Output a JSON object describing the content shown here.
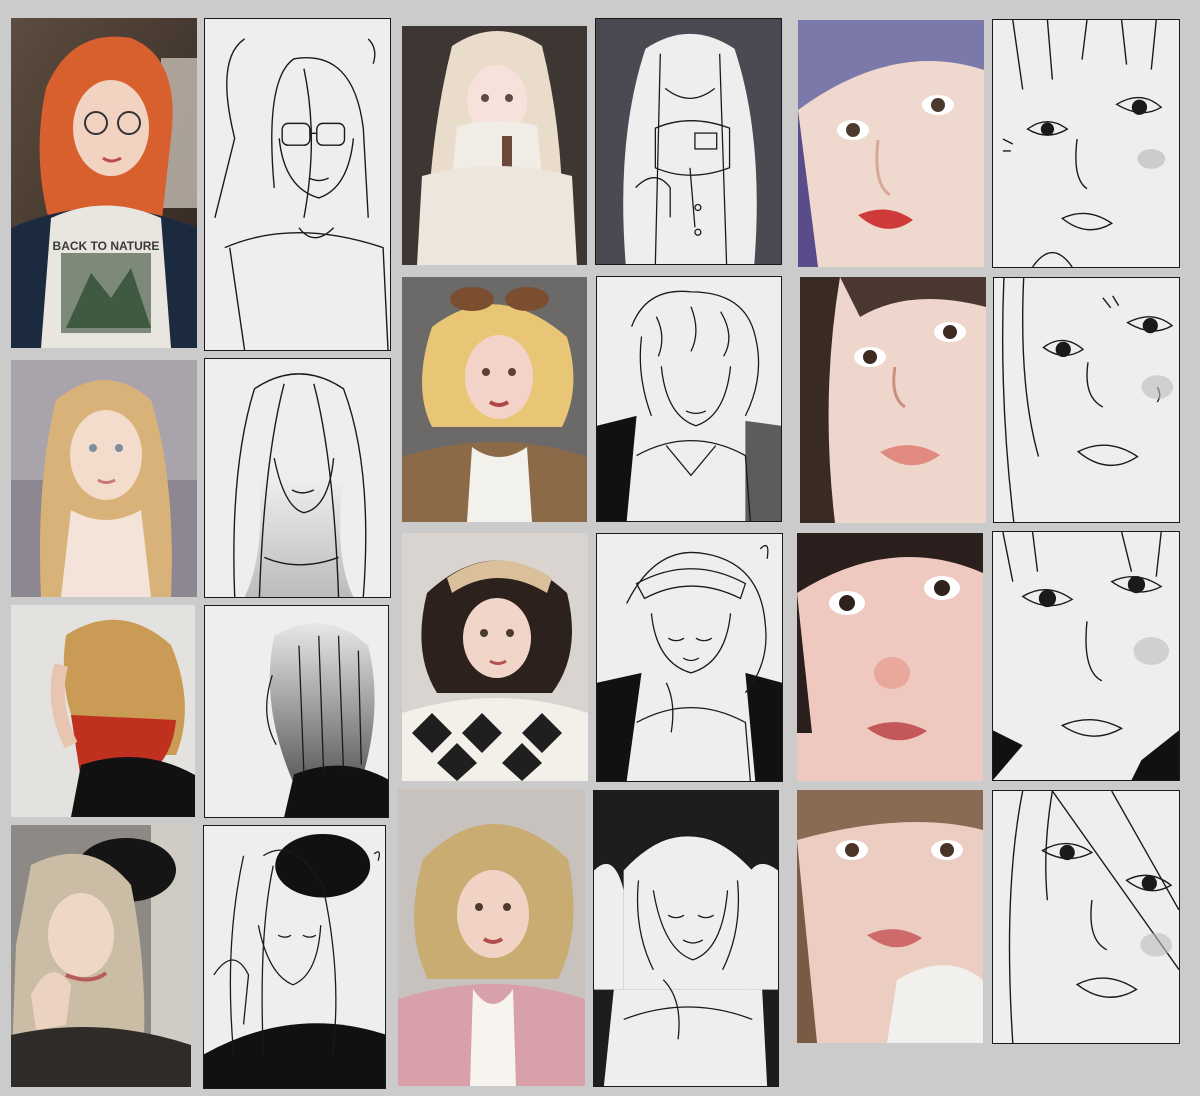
{
  "board": {
    "background": "#cbcbcb",
    "sketch_paper": "#eeeeee",
    "ink": "#1a1a1a"
  },
  "photo_shirt_text": "BACK TO NATURE"
}
